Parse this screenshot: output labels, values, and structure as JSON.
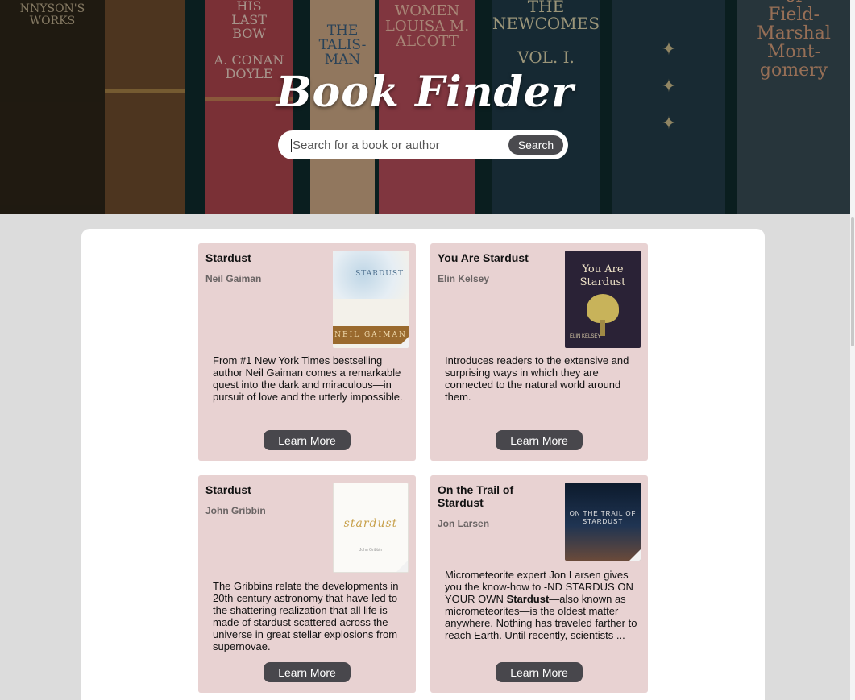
{
  "header": {
    "title": "Book Finder",
    "spines": [
      {
        "text": "NNYSON'S\nWORKS"
      },
      {
        "text": "HIS\nLAST\nBOW\n\nA. CONAN\nDOYLE"
      },
      {
        "text": "THE\nTALIS-\nMAN"
      },
      {
        "text": "LITTLE\nWOMEN\nLOUISA M.\nALCOTT"
      },
      {
        "text": "THE\nNEWCOMES\n\nVOL. I."
      },
      {
        "text": "✦\n\n✦\n\n✦"
      },
      {
        "text": "of\nField-\nMarshal\nMont-\ngomery"
      }
    ]
  },
  "search": {
    "placeholder": "Search for a book or author",
    "button_label": "Search"
  },
  "results": [
    {
      "title": "Stardust",
      "author": "Neil Gaiman",
      "description": "From #1 New York Times bestselling author Neil Gaiman comes a remarkable quest into the dark and miraculous—in pursuit of love and the utterly impossible.",
      "button_label": "Learn More",
      "cover": {
        "top_text": "STARDUST",
        "bottom_text": "NEIL GAIMAN"
      }
    },
    {
      "title": "You Are Stardust",
      "author": "Elin Kelsey",
      "description": "Introduces readers to the extensive and surprising ways in which they are connected to the natural world around them.",
      "button_label": "Learn More",
      "cover": {
        "top_text": "You Are\nStardust",
        "bottom_text": "ELIN KELSEY"
      }
    },
    {
      "title": "Stardust",
      "author": "John Gribbin",
      "description": "The Gribbins relate the developments in 20th-century astronomy that have led to the shattering realization that all life is made of stardust scattered across the universe in great stellar explosions from supernovae.",
      "button_label": "Learn More",
      "cover": {
        "top_text": "stardust",
        "bottom_text": "John Gribbin"
      }
    },
    {
      "title": "On the Trail of Stardust",
      "author": "Jon Larsen",
      "description_before": "Micrometeorite expert Jon Larsen gives you the know-how to -ND STARDUS ON YOUR OWN ",
      "description_bold": "Stardust",
      "description_after": "—also known as micrometeorites—is the oldest matter anywhere. Nothing has traveled farther to reach Earth. Until recently, scientists ...",
      "button_label": "Learn More",
      "cover": {
        "top_text": "ON THE TRAIL OF\nSTARDUST",
        "bottom_text": ""
      }
    }
  ]
}
